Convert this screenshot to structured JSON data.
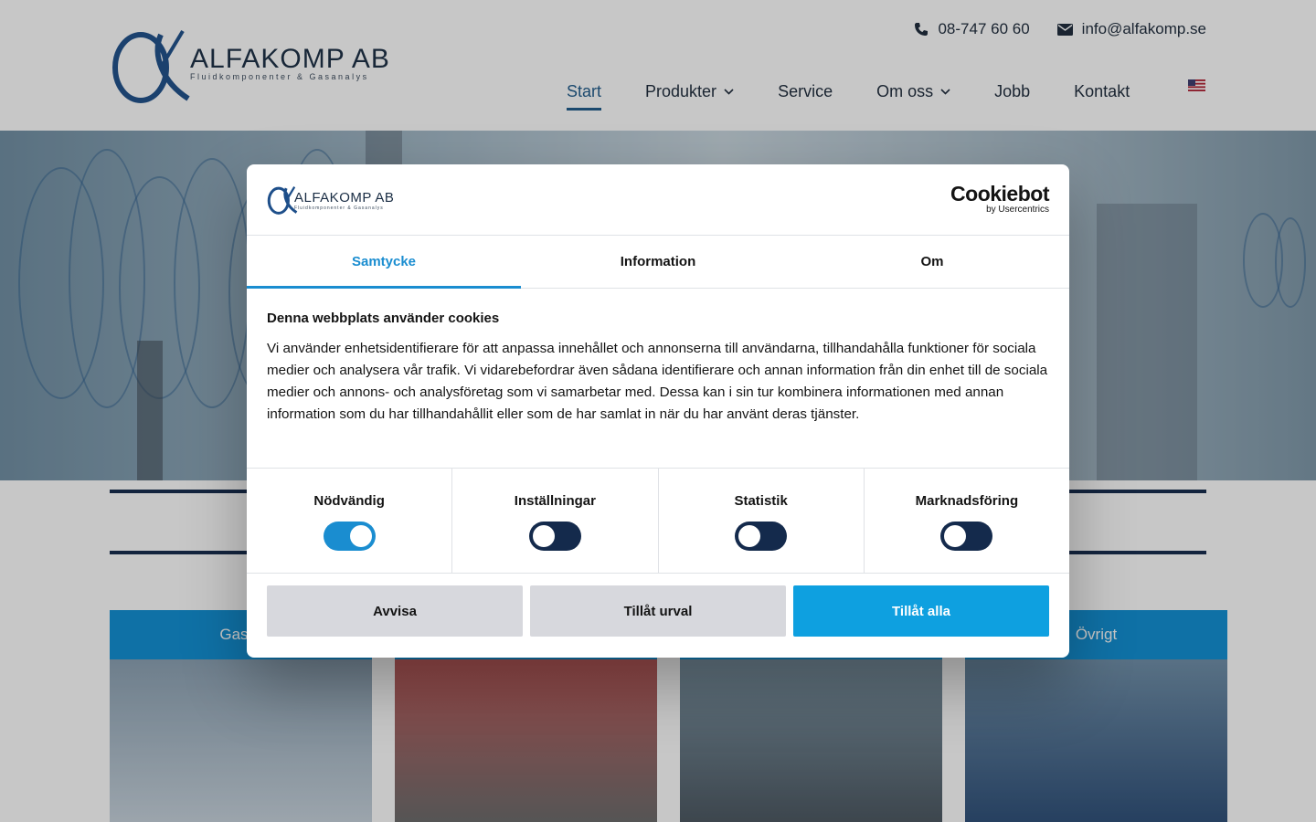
{
  "site": {
    "logo_name": "ALFAKOMP AB",
    "logo_tagline": "Fluidkomponenter & Gasanalys",
    "phone": "08-747 60 60",
    "email": "info@alfakomp.se",
    "nav": [
      {
        "label": "Start",
        "active": true
      },
      {
        "label": "Produkter",
        "dropdown": true
      },
      {
        "label": "Service"
      },
      {
        "label": "Om oss",
        "dropdown": true
      },
      {
        "label": "Jobb"
      },
      {
        "label": "Kontakt"
      }
    ],
    "categories": [
      {
        "label": "Gasar"
      },
      {
        "label": ""
      },
      {
        "label": ""
      },
      {
        "label": "Övrigt"
      }
    ]
  },
  "cookie": {
    "brand": "Cookiebot",
    "brand_sub": "by Usercentrics",
    "tabs": [
      "Samtycke",
      "Information",
      "Om"
    ],
    "heading": "Denna webbplats använder cookies",
    "body": "Vi använder enhetsidentifierare för att anpassa innehållet och annonserna till användarna, tillhandahålla funktioner för sociala medier och analysera vår trafik. Vi vidarebefordrar även sådana identifierare och annan information från din enhet till de sociala medier och annons- och analysföretag som vi samarbetar med. Dessa kan i sin tur kombinera informationen med annan information som du har tillhandahållit eller som de har samlat in när du har använt deras tjänster.",
    "toggles": [
      {
        "label": "Nödvändig",
        "on": true
      },
      {
        "label": "Inställningar",
        "on": false
      },
      {
        "label": "Statistik",
        "on": false
      },
      {
        "label": "Marknadsföring",
        "on": false
      }
    ],
    "buttons": {
      "reject": "Avvisa",
      "allow_selection": "Tillåt urval",
      "allow_all": "Tillåt alla"
    }
  },
  "colors": {
    "accent": "#1a8dd0",
    "brand_dark": "#13294b",
    "category_blue": "#0e8fd4"
  }
}
